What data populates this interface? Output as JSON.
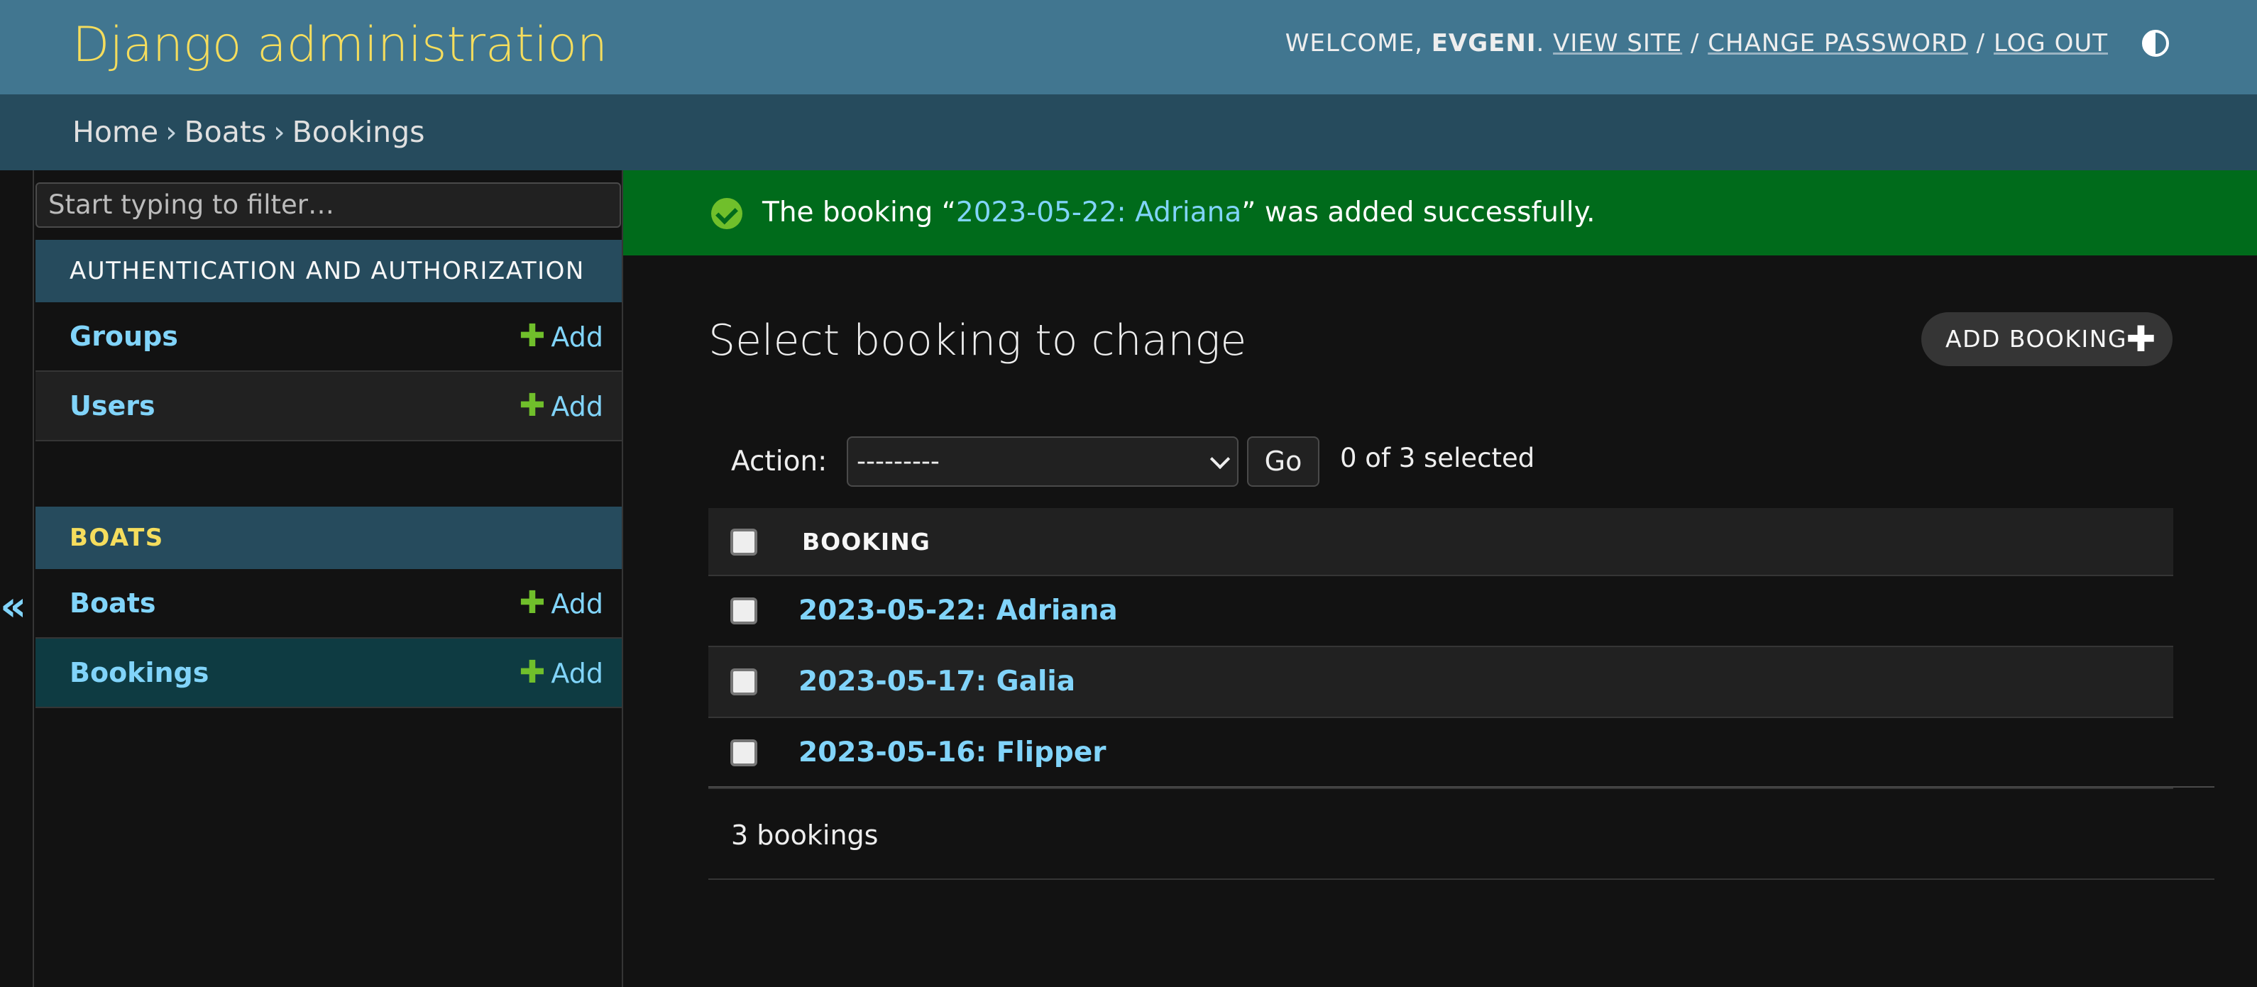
{
  "header": {
    "site_name": "Django administration",
    "welcome": "WELCOME,",
    "username": "EVGENI",
    "view_site": "VIEW SITE",
    "change_password": "CHANGE PASSWORD",
    "log_out": "LOG OUT",
    "separator": "/",
    "theme_toggle_icon": "theme-toggle-icon"
  },
  "breadcrumbs": {
    "items": [
      "Home",
      "Boats",
      "Bookings"
    ],
    "separator": "›"
  },
  "sidebar": {
    "filter_placeholder": "Start typing to filter…",
    "collapse_icon": "«",
    "modules": [
      {
        "caption": "AUTHENTICATION AND AUTHORIZATION",
        "models": [
          {
            "name": "Groups",
            "add": "Add"
          },
          {
            "name": "Users",
            "add": "Add"
          }
        ]
      },
      {
        "caption": "BOATS",
        "models": [
          {
            "name": "Boats",
            "add": "Add"
          },
          {
            "name": "Bookings",
            "add": "Add"
          }
        ]
      }
    ]
  },
  "message": {
    "prefix": "The booking “",
    "link": "2023-05-22: Adriana",
    "suffix": "” was added successfully."
  },
  "content": {
    "title": "Select booking to change",
    "add_button": "ADD BOOKING",
    "action_label": "Action:",
    "action_selected": "---------",
    "go_button": "Go",
    "counter": "0 of 3 selected",
    "column_header": "BOOKING",
    "rows": [
      "2023-05-22: Adriana",
      "2023-05-17: Galia",
      "2023-05-16: Flipper"
    ],
    "paginator": "3 bookings"
  },
  "colors": {
    "header_bg": "#417690",
    "breadcrumbs_bg": "#264b5d",
    "accent_yellow": "#f5dd5d",
    "link_blue": "#81d4fa",
    "success_bg": "#006b1b",
    "add_green": "#70bf2b"
  }
}
